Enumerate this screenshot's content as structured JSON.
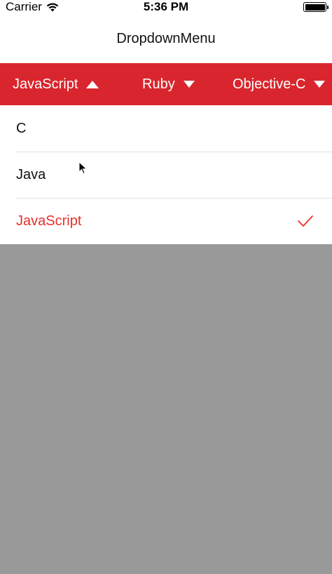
{
  "status_bar": {
    "carrier": "Carrier",
    "time": "5:36 PM",
    "icons": [
      "wifi-icon",
      "battery-icon"
    ],
    "battery_level": 1.0
  },
  "nav": {
    "title": "DropdownMenu"
  },
  "tabs": [
    {
      "label": "JavaScript",
      "state": "expanded",
      "icon": "arrow-up-icon"
    },
    {
      "label": "Ruby",
      "state": "collapsed",
      "icon": "arrow-down-icon"
    },
    {
      "label": "Objective-C",
      "state": "collapsed",
      "icon": "arrow-down-icon"
    }
  ],
  "dropdown": {
    "options": [
      {
        "label": "C",
        "selected": false
      },
      {
        "label": "Java",
        "selected": false
      },
      {
        "label": "JavaScript",
        "selected": true,
        "icon": "checkmark-icon"
      }
    ]
  },
  "colors": {
    "accent": "#d9262e",
    "selected_text": "#e8302a",
    "overlay": "#999999",
    "background": "#ffffff"
  }
}
